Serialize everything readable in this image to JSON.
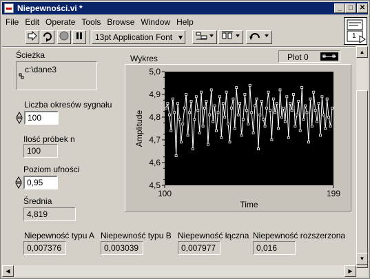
{
  "window": {
    "title": "Niepewności.vi *"
  },
  "menu": [
    "File",
    "Edit",
    "Operate",
    "Tools",
    "Browse",
    "Window",
    "Help"
  ],
  "toolbar": {
    "font": "13pt Application Font"
  },
  "connector": {
    "label": "1"
  },
  "path": {
    "label": "Ścieżka",
    "value": "c:\\dane3"
  },
  "periods": {
    "label": "Liczba okresów sygnału",
    "value": "100"
  },
  "samples": {
    "label": "Ilość próbek n",
    "value": "100"
  },
  "confidence": {
    "label": "Poziom ufności",
    "value": "0,95"
  },
  "mean": {
    "label": "Średnia",
    "value": "4,819"
  },
  "uncert_a": {
    "label": "Niepewność typu A",
    "value": "0,007376"
  },
  "uncert_b": {
    "label": "Niepewność typu B",
    "value": "0,003039"
  },
  "uncert_c": {
    "label": "Niepewność łączna",
    "value": "0,007977"
  },
  "uncert_exp": {
    "label": "Niepewność rozszerzona",
    "value": "0,016"
  },
  "graph": {
    "label": "Wykres",
    "legend": "Plot 0"
  },
  "chart_data": {
    "type": "line",
    "title": "Wykres",
    "xlabel": "Time",
    "ylabel": "Amplitude",
    "xlim": [
      100,
      199
    ],
    "ylim": [
      4.5,
      5.0
    ],
    "x_ticks": [
      "100",
      "199"
    ],
    "y_ticks": [
      "4,5",
      "4,6",
      "4,7",
      "4,8",
      "4,9",
      "5,0"
    ],
    "grid": false,
    "series": [
      {
        "name": "Plot 0",
        "color": "#ffffff",
        "values": [
          4.84,
          4.86,
          4.81,
          4.74,
          4.88,
          4.82,
          4.63,
          4.86,
          4.79,
          4.69,
          4.77,
          4.84,
          4.9,
          4.72,
          4.82,
          4.87,
          4.66,
          4.79,
          4.89,
          4.83,
          4.73,
          4.91,
          4.76,
          4.84,
          4.87,
          4.68,
          4.81,
          4.92,
          4.78,
          4.85,
          4.74,
          4.82,
          4.89,
          4.71,
          4.86,
          4.8,
          4.91,
          4.77,
          4.69,
          4.84,
          4.88,
          4.75,
          4.93,
          4.81,
          4.86,
          4.72,
          4.79,
          4.9,
          4.83,
          4.77,
          4.94,
          4.82,
          4.73,
          4.85,
          4.88,
          4.66,
          4.81,
          4.87,
          4.79,
          4.76,
          4.84,
          4.91,
          4.83,
          4.7,
          4.88,
          4.82,
          4.86,
          4.75,
          4.92,
          4.8,
          4.84,
          4.78,
          4.89,
          4.71,
          4.86,
          4.83,
          4.9,
          4.76,
          4.81,
          4.87,
          4.74,
          4.93,
          4.79,
          4.85,
          4.82,
          4.69,
          4.88,
          4.76,
          4.91,
          4.83,
          4.78,
          4.86,
          4.72,
          4.89,
          4.81,
          4.75,
          4.88,
          4.8,
          4.76,
          4.84
        ]
      }
    ]
  }
}
